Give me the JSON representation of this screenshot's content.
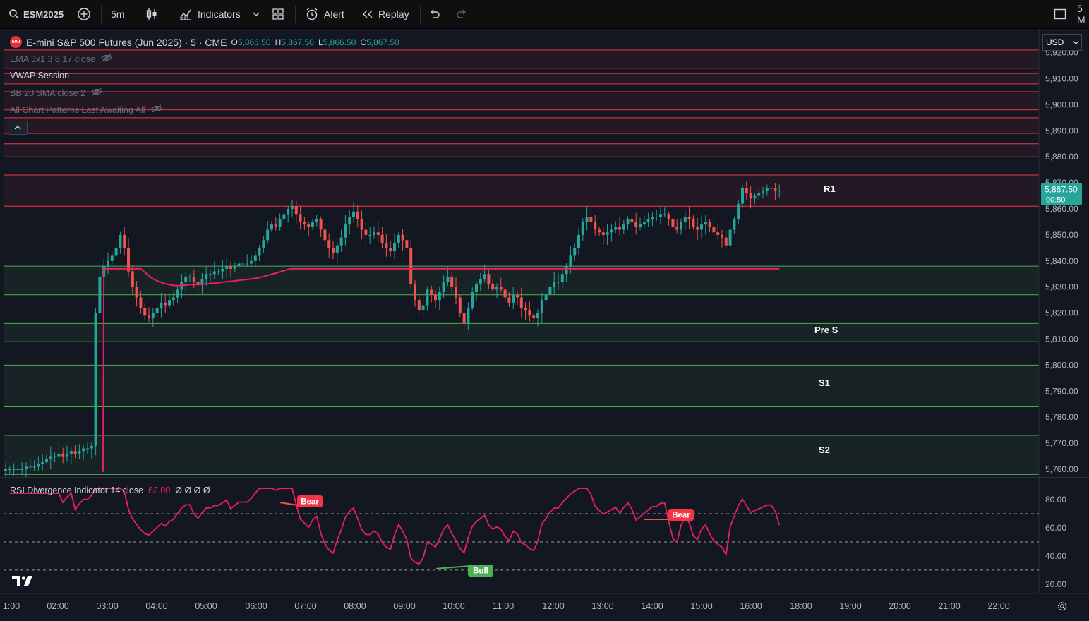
{
  "toolbar": {
    "symbol": "ESM2025",
    "interval": "5m",
    "indicators": "Indicators",
    "alert": "Alert",
    "replay": "Replay",
    "right_cut": "5 M"
  },
  "legend": {
    "title": "E-mini S&P 500 Futures (Jun 2025) · 5 · CME",
    "badge": "500",
    "o_label": "O",
    "o": "5,866.50",
    "h_label": "H",
    "h": "5,867.50",
    "l_label": "L",
    "l": "5,866.50",
    "c_label": "C",
    "c": "5,867.50",
    "indicators": [
      {
        "label": "EMA 3x1 3 8 17 close",
        "hidden": true
      },
      {
        "label": "VWAP Session",
        "hidden": false
      },
      {
        "label": "BB 20 SMA close 2",
        "hidden": true
      },
      {
        "label": "All Chart Patterns Last Awaiting All",
        "hidden": true
      }
    ]
  },
  "currency": "USD",
  "price_axis": {
    "ticks": [
      "5,920.00",
      "5,910.00",
      "5,900.00",
      "5,890.00",
      "5,880.00",
      "5,870.00",
      "5,860.00",
      "5,850.00",
      "5,840.00",
      "5,830.00",
      "5,820.00",
      "5,810.00",
      "5,800.00",
      "5,790.00",
      "5,780.00",
      "5,770.00",
      "5,760.00"
    ],
    "last_price": "5,867.50",
    "countdown": "00:50"
  },
  "levels": [
    {
      "label": "R1"
    },
    {
      "label": "Pre S"
    },
    {
      "label": "S1"
    },
    {
      "label": "S2"
    }
  ],
  "rsi": {
    "title": "RSI Divergence Indicator 14 close",
    "value": "62.00",
    "extras": "Ø Ø Ø Ø",
    "ticks": [
      "80.00",
      "60.00",
      "40.00",
      "20.00"
    ],
    "labels": [
      "Bear",
      "Bear",
      "Bull"
    ]
  },
  "time_axis": {
    "ticks": [
      "1:00",
      "02:00",
      "03:00",
      "04:00",
      "05:00",
      "06:00",
      "07:00",
      "08:00",
      "09:00",
      "10:00",
      "11:00",
      "12:00",
      "13:00",
      "14:00",
      "15:00",
      "16:00",
      "18:00",
      "19:00",
      "20:00",
      "21:00",
      "22:00"
    ]
  },
  "colors": {
    "up": "#26a69a",
    "down": "#ef5350",
    "vwap": "#e91e63",
    "resistance": "#f23645",
    "support": "#4caf50",
    "background": "#131722"
  },
  "chart_data": {
    "type": "candlestick",
    "symbol": "ESM2025",
    "price_range": [
      5755,
      5925
    ],
    "rsi_range": [
      15,
      90
    ],
    "rsi_bands": [
      70,
      50,
      30
    ],
    "resistance_zones": [
      [
        5861,
        5873
      ],
      [
        5880,
        5885
      ],
      [
        5889,
        5895
      ],
      [
        5898,
        5905
      ],
      [
        5908,
        5912
      ],
      [
        5914,
        5921
      ]
    ],
    "support_zones": [
      {
        "name": "",
        "range": [
          5827,
          5838
        ]
      },
      {
        "name": "Pre S",
        "range": [
          5809,
          5816
        ]
      },
      {
        "name": "S1",
        "range": [
          5784,
          5800
        ]
      },
      {
        "name": "S2",
        "range": [
          5758,
          5773
        ]
      }
    ],
    "close": [
      5760,
      5760,
      5760,
      5760,
      5760,
      5761,
      5761,
      5761,
      5762,
      5763,
      5764,
      5765,
      5765,
      5766,
      5765,
      5766,
      5767,
      5766,
      5767,
      5768,
      5768,
      5769,
      5820,
      5834,
      5838,
      5840,
      5842,
      5845,
      5850,
      5845,
      5836,
      5830,
      5826,
      5822,
      5819,
      5818,
      5820,
      5822,
      5824,
      5823,
      5825,
      5826,
      5829,
      5832,
      5834,
      5834,
      5832,
      5831,
      5833,
      5835,
      5835,
      5836,
      5836,
      5837,
      5838,
      5837,
      5838,
      5839,
      5839,
      5839,
      5840,
      5842,
      5845,
      5848,
      5852,
      5854,
      5853,
      5856,
      5858,
      5860,
      5861,
      5858,
      5855,
      5854,
      5853,
      5855,
      5856,
      5852,
      5848,
      5845,
      5843,
      5846,
      5849,
      5854,
      5857,
      5859,
      5856,
      5852,
      5850,
      5850,
      5851,
      5850,
      5847,
      5845,
      5844,
      5847,
      5850,
      5848,
      5845,
      5831,
      5825,
      5821,
      5823,
      5829,
      5827,
      5825,
      5828,
      5832,
      5834,
      5830,
      5826,
      5820,
      5816,
      5822,
      5828,
      5831,
      5833,
      5835,
      5831,
      5829,
      5830,
      5829,
      5826,
      5824,
      5827,
      5826,
      5822,
      5821,
      5819,
      5818,
      5820,
      5825,
      5827,
      5830,
      5832,
      5832,
      5835,
      5838,
      5842,
      5845,
      5850,
      5855,
      5857,
      5855,
      5852,
      5851,
      5850,
      5851,
      5852,
      5853,
      5852,
      5854,
      5856,
      5855,
      5853,
      5854,
      5855,
      5856,
      5857,
      5857,
      5858,
      5858,
      5856,
      5853,
      5852,
      5855,
      5857,
      5856,
      5853,
      5852,
      5854,
      5855,
      5853,
      5851,
      5850,
      5849,
      5846,
      5852,
      5856,
      5862,
      5868,
      5866,
      5864,
      5865,
      5866,
      5867,
      5868,
      5868,
      5867,
      5867
    ],
    "vwap_last": 5837,
    "rsi_last": 62.0
  }
}
